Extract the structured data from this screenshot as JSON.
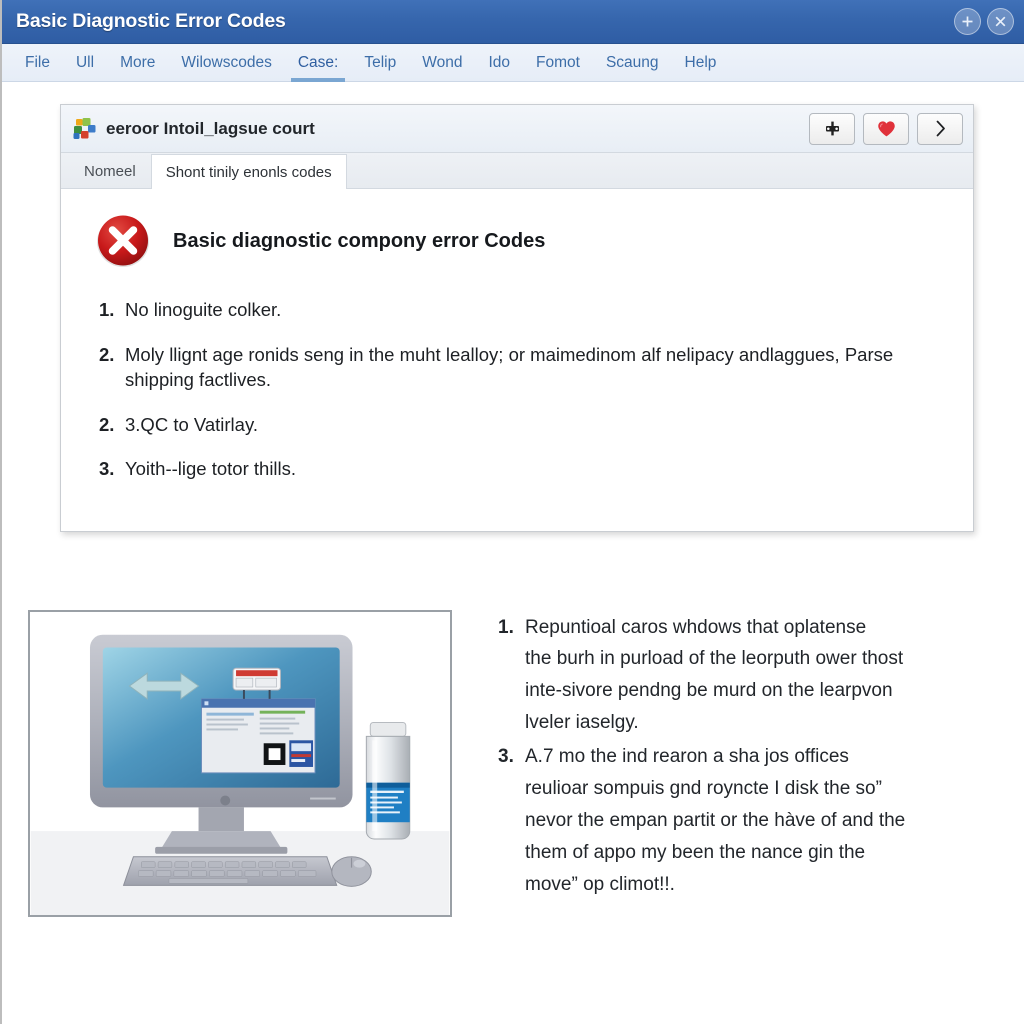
{
  "window": {
    "title": "Basic Diagnostic Error Codes",
    "buttons": [
      {
        "name": "plus-button",
        "glyph": "+"
      },
      {
        "name": "close-button",
        "glyph": "×"
      }
    ]
  },
  "menubar": {
    "items": [
      {
        "label": "File",
        "active": false
      },
      {
        "label": "Ull",
        "active": false
      },
      {
        "label": "More",
        "active": false
      },
      {
        "label": "Wilowscodes",
        "active": false
      },
      {
        "label": "Case:",
        "active": true
      },
      {
        "label": "Telip",
        "active": false
      },
      {
        "label": "Wond",
        "active": false
      },
      {
        "label": "Ido",
        "active": false
      },
      {
        "label": "Fomot",
        "active": false
      },
      {
        "label": "Scaung",
        "active": false
      },
      {
        "label": "Help",
        "active": false
      }
    ]
  },
  "card": {
    "header": {
      "icon": "puzzle-pieces-icon",
      "title": "eeroor Intoil_lagsue court",
      "actions": [
        {
          "name": "settings-button",
          "icon": "gear-icon"
        },
        {
          "name": "favorite-button",
          "icon": "heart-icon"
        },
        {
          "name": "next-button",
          "icon": "chevron-right-icon"
        }
      ]
    },
    "tabs": [
      {
        "label": "Nomeel",
        "selected": false
      },
      {
        "label": "Shont tinily enonls codes",
        "selected": true
      }
    ],
    "error": {
      "icon": "error-circle-x-icon",
      "title": "Basic diagnostic compony error Codes",
      "items": [
        {
          "num": "1.",
          "text": "No linoguite colker."
        },
        {
          "num": "2.",
          "text": "Moly llignt age ronids seng in the muht lealloy; or maimedinom alf nelipacy andlaggues, Parse shipping factlives."
        },
        {
          "num": "2.",
          "text": "3.QC to Vatirlay."
        },
        {
          "num": "3.",
          "text": "Yoith--lige totor thills."
        }
      ]
    }
  },
  "lower": {
    "figure": {
      "name": "computer-monitor-illustration",
      "alt": "Desktop computer with monitor, keyboard, mouse and a supplement bottle"
    },
    "items": [
      {
        "num": "1.",
        "lines": [
          "Repuntioal caros whdows that oplatense",
          "the burh in purload of the leorputh ower thost",
          "inte-sivore pendng be murd on the learpvon",
          "lveler iaselgy."
        ]
      },
      {
        "num": "3.",
        "lines": [
          "A.7 mo the ind rearon a sha jos offices",
          "reulioar sompuis gnd royncte I disk the so”",
          "nevor the empan partit or the hàve of and the",
          "them of appo my been the nance gin the",
          "move” op climot!!."
        ]
      }
    ]
  },
  "colors": {
    "titlebar": "#3666ad",
    "menu_text": "#3d6ea8",
    "error_red": "#c41a1a",
    "heart_red": "#e0313a",
    "accent_underline": "#7aa6d2"
  }
}
